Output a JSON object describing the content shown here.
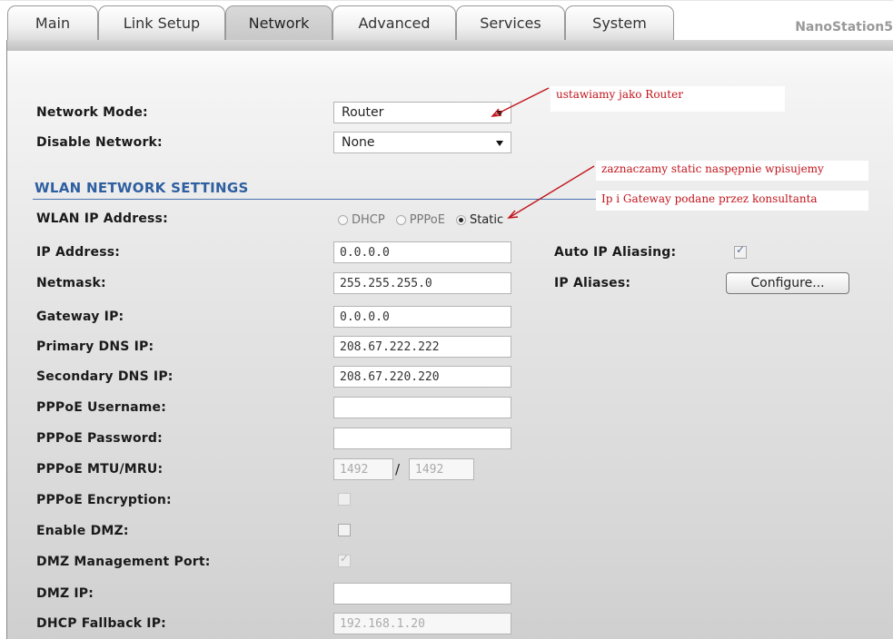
{
  "tabs": [
    {
      "label": "Main",
      "active": false
    },
    {
      "label": "Link Setup",
      "active": false
    },
    {
      "label": "Network",
      "active": true
    },
    {
      "label": "Advanced",
      "active": false
    },
    {
      "label": "Services",
      "active": false
    },
    {
      "label": "System",
      "active": false
    }
  ],
  "brand": "NanoStation5",
  "network_mode": {
    "label": "Network Mode:",
    "value": "Router"
  },
  "disable_network": {
    "label": "Disable Network:",
    "value": "None"
  },
  "wlan_section_title": "WLAN NETWORK SETTINGS",
  "wlan_ip_address": {
    "label": "WLAN IP Address:",
    "options": [
      "DHCP",
      "PPPoE",
      "Static"
    ],
    "selected": "Static"
  },
  "fields": {
    "ip_address": {
      "label": "IP Address:",
      "value": "0.0.0.0"
    },
    "netmask": {
      "label": "Netmask:",
      "value": "255.255.255.0"
    },
    "gateway": {
      "label": "Gateway IP:",
      "value": "0.0.0.0"
    },
    "primary_dns": {
      "label": "Primary DNS IP:",
      "value": "208.67.222.222"
    },
    "secondary_dns": {
      "label": "Secondary DNS IP:",
      "value": "208.67.220.220"
    },
    "pppoe_username": {
      "label": "PPPoE Username:",
      "value": ""
    },
    "pppoe_password": {
      "label": "PPPoE Password:",
      "value": ""
    },
    "pppoe_mtu_mru": {
      "label": "PPPoE MTU/MRU:",
      "mtu": "1492",
      "mru": "1492"
    },
    "pppoe_encryption": {
      "label": "PPPoE Encryption:",
      "checked": false
    },
    "enable_dmz": {
      "label": "Enable DMZ:",
      "checked": false
    },
    "dmz_management_port": {
      "label": "DMZ Management Port:",
      "checked": true
    },
    "dmz_ip": {
      "label": "DMZ IP:",
      "value": ""
    },
    "dhcp_fallback_ip": {
      "label": "DHCP Fallback IP:",
      "value": "192.168.1.20"
    }
  },
  "auto_ip_aliasing": {
    "label": "Auto IP Aliasing:",
    "checked": true
  },
  "ip_aliases": {
    "label": "IP Aliases:",
    "button": "Configure..."
  },
  "annotations": {
    "router_note": "ustawiamy jako Router",
    "static_note_line1": "zaznaczamy static naspępnie wpisujemy",
    "static_note_line2": "Ip i Gateway podane przez konsultanta"
  },
  "colors": {
    "section_title": "#2e5fa0",
    "annotation": "#c0141c"
  }
}
